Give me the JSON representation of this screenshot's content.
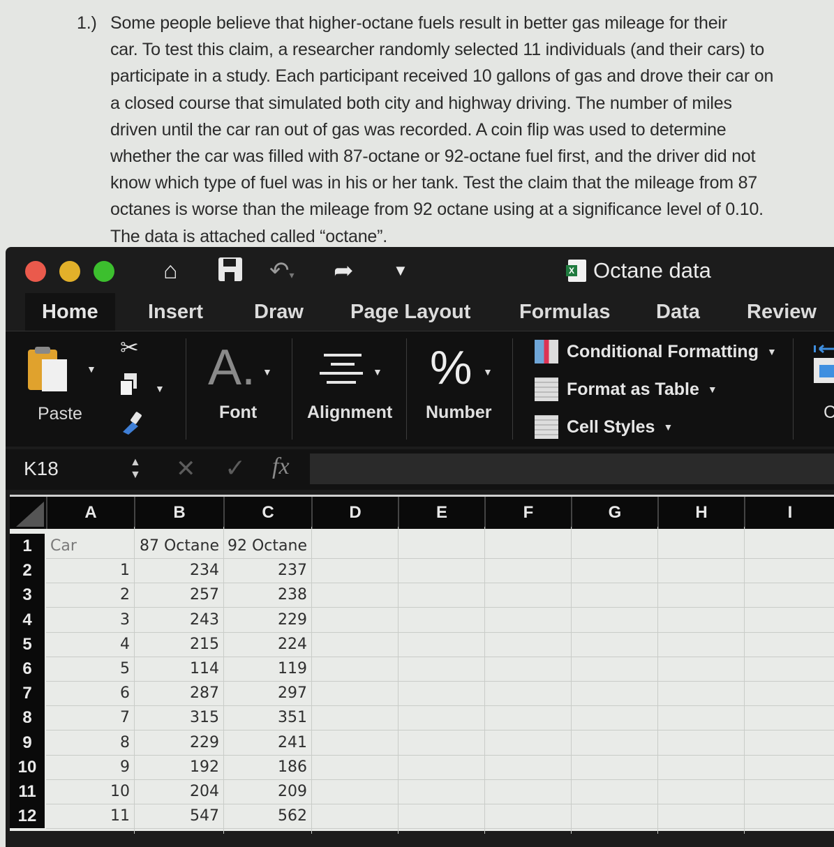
{
  "question": {
    "number": "1.)",
    "lines": [
      "Some people believe that higher-octane fuels result in better gas mileage for their",
      "car.  To test this claim, a researcher randomly selected 11 individuals (and their cars) to",
      "participate in a study.  Each participant received 10 gallons of gas and drove their car on",
      "a closed course that simulated both city and highway driving.  The number of miles",
      "driven until the car ran out of gas was recorded.  A coin flip was used to determine",
      "whether the car was filled with 87-octane or 92-octane fuel first, and the driver did not",
      "know which type of fuel was in his or her tank. Test the claim that the mileage from 87",
      "octanes is worse than the mileage from 92 octane using at a significance level of 0.10.",
      "The data is attached called “octane”."
    ]
  },
  "window": {
    "title": "Octane data",
    "toolbar_icons": [
      "home-icon",
      "save-icon",
      "undo-icon",
      "redo-icon",
      "customize-toolbar-icon"
    ]
  },
  "tabs": [
    "Home",
    "Insert",
    "Draw",
    "Page Layout",
    "Formulas",
    "Data",
    "Review"
  ],
  "active_tab": "Home",
  "ribbon": {
    "paste": "Paste",
    "font": "Font",
    "alignment": "Alignment",
    "number": "Number",
    "font_glyph": "A.",
    "number_glyph": "%",
    "styles": [
      "Conditional Formatting",
      "Format as Table",
      "Cell Styles"
    ],
    "cells_partial": "C"
  },
  "formula_bar": {
    "name_box": "K18",
    "cancel": "✕",
    "enter": "✓",
    "fx": "fx",
    "value": ""
  },
  "sheet": {
    "columns": [
      "A",
      "B",
      "C",
      "D",
      "E",
      "F",
      "G",
      "H",
      "I"
    ],
    "row_numbers": [
      "1",
      "2",
      "3",
      "4",
      "5",
      "6",
      "7",
      "8",
      "9",
      "10",
      "11",
      "12"
    ],
    "header": [
      "Car",
      "87 Octane",
      "92 Octane"
    ],
    "rows": [
      [
        "1",
        "234",
        "237"
      ],
      [
        "2",
        "257",
        "238"
      ],
      [
        "3",
        "243",
        "229"
      ],
      [
        "4",
        "215",
        "224"
      ],
      [
        "5",
        "114",
        "119"
      ],
      [
        "6",
        "287",
        "297"
      ],
      [
        "7",
        "315",
        "351"
      ],
      [
        "8",
        "229",
        "241"
      ],
      [
        "9",
        "192",
        "186"
      ],
      [
        "10",
        "204",
        "209"
      ],
      [
        "11",
        "547",
        "562"
      ]
    ]
  }
}
